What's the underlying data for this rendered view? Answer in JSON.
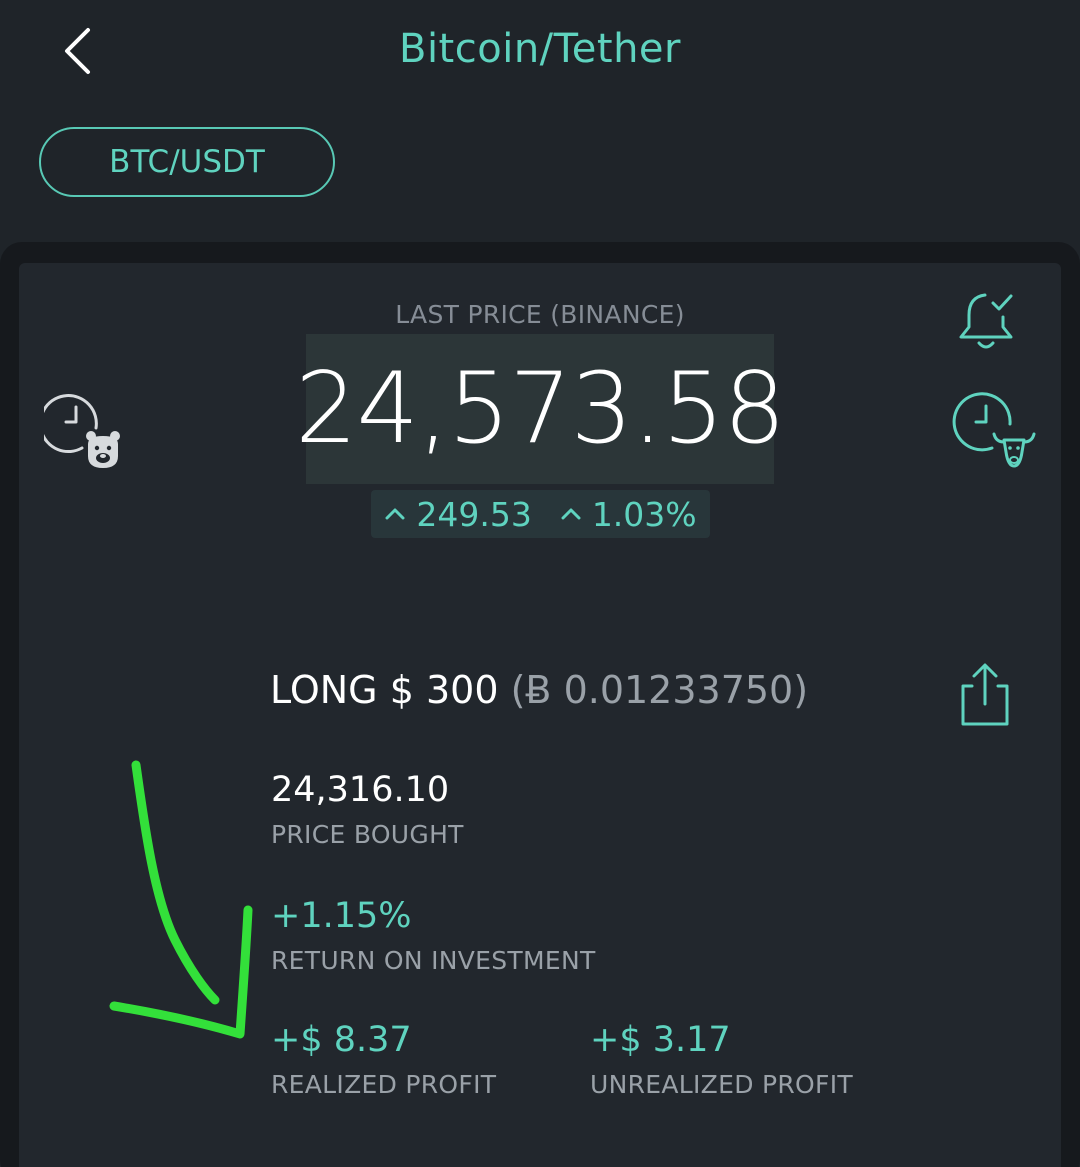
{
  "header": {
    "title": "Bitcoin/Tether",
    "back_icon": "chevron-left-icon"
  },
  "pair": {
    "label": "BTC/USDT"
  },
  "ticker": {
    "last_price_label": "LAST PRICE (BINANCE)",
    "last_price": "24,573.58",
    "change_abs": "249.53",
    "change_pct": "1.03%",
    "change_direction": "up"
  },
  "icons": {
    "bear_alarm": "bear-clock-icon",
    "bull_alarm": "bull-clock-icon",
    "alert": "bell-check-icon",
    "share": "share-icon"
  },
  "position": {
    "side": "LONG",
    "amount": "$ 300",
    "btc_amount": "(Ƀ 0.01233750)"
  },
  "stats": {
    "price_bought": {
      "value": "24,316.10",
      "label": "PRICE BOUGHT"
    },
    "roi": {
      "value": "+1.15%",
      "label": "RETURN ON INVESTMENT"
    },
    "realized": {
      "value": "+$ 8.37",
      "label": "REALIZED PROFIT"
    },
    "unrealized": {
      "value": "+$ 3.17",
      "label": "UNREALIZED PROFIT"
    }
  },
  "colors": {
    "background": "#1f2429",
    "card": "#22272d",
    "accent": "#5fd3bf",
    "annotation": "#33e03a"
  }
}
